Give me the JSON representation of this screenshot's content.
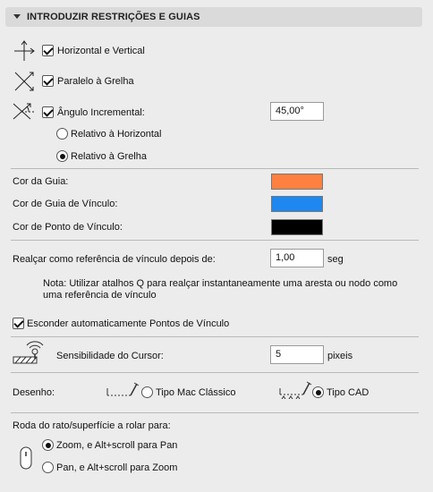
{
  "header": {
    "title": "INTRODUZIR RESTRIÇÕES E GUIAS"
  },
  "options": {
    "horizontal_vertical": {
      "label": "Horizontal e Vertical",
      "checked": true
    },
    "paralelo_grelha": {
      "label": "Paralelo à Grelha",
      "checked": true
    },
    "angulo_incremental": {
      "label": "Ângulo Incremental:",
      "checked": true,
      "value": "45,00°"
    },
    "relativo_horizontal": {
      "label": "Relativo à Horizontal",
      "selected": false
    },
    "relativo_grelha": {
      "label": "Relativo à Grelha",
      "selected": true
    }
  },
  "colors": {
    "cor_guia": {
      "label": "Cor da Guia:",
      "hex": "#ff8040"
    },
    "cor_guia_vinculo": {
      "label": "Cor de Guia de Vínculo:",
      "hex": "#1e88f0"
    },
    "cor_ponto_vinculo": {
      "label": "Cor de Ponto de Vínculo:",
      "hex": "#000000"
    }
  },
  "realcar": {
    "label": "Realçar como referência de vínculo depois de:",
    "value": "1,00",
    "unit": "seg",
    "note": "Nota: Utilizar atalhos Q para realçar instantaneamente uma aresta ou nodo como uma referência de vínculo"
  },
  "esconder": {
    "label": "Esconder automaticamente Pontos de Vínculo",
    "checked": true
  },
  "sensibilidade": {
    "label": "Sensibilidade do Cursor:",
    "value": "5",
    "unit": "pixeis"
  },
  "desenho": {
    "label": "Desenho:",
    "mac_classico": {
      "label": "Tipo Mac Clássico",
      "selected": false
    },
    "cad": {
      "label": "Tipo CAD",
      "selected": true
    }
  },
  "roda": {
    "label": "Roda do rato/superfície a rolar para:",
    "zoom": {
      "label": "Zoom, e Alt+scroll para Pan",
      "selected": true
    },
    "pan": {
      "label": "Pan, e Alt+scroll para Zoom",
      "selected": false
    }
  }
}
